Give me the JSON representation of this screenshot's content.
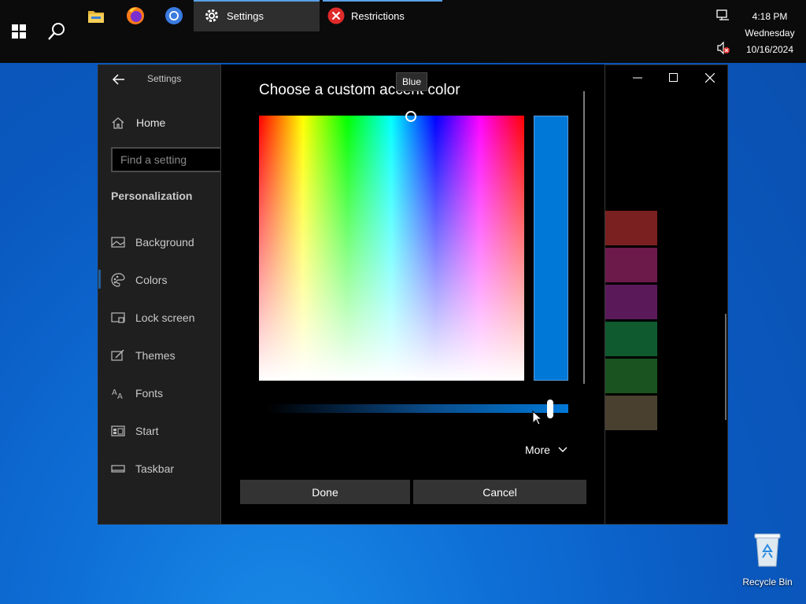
{
  "taskbar": {
    "settings_label": "Settings",
    "restrictions_label": "Restrictions",
    "time": "4:18 PM",
    "day": "Wednesday",
    "date": "10/16/2024"
  },
  "settings_window": {
    "title": "Settings",
    "home_label": "Home",
    "search_placeholder": "Find a setting",
    "section_title": "Personalization",
    "nav_items": [
      {
        "label": "Background",
        "icon": "image-icon"
      },
      {
        "label": "Colors",
        "icon": "palette-icon"
      },
      {
        "label": "Lock screen",
        "icon": "lock-screen-icon"
      },
      {
        "label": "Themes",
        "icon": "themes-icon"
      },
      {
        "label": "Fonts",
        "icon": "fonts-icon"
      },
      {
        "label": "Start",
        "icon": "start-icon"
      },
      {
        "label": "Taskbar",
        "icon": "taskbar-icon"
      }
    ],
    "selected_item": "Colors",
    "swatch_colors": [
      "#7b2020",
      "#6b1a4a",
      "#5a1a5a",
      "#0f5a2f",
      "#1a5220",
      "#4a4030"
    ]
  },
  "dialog": {
    "title": "Choose a custom accent color",
    "tooltip": "Blue",
    "preview_color": "#0078d7",
    "brightness_value": 0.95,
    "more_label": "More",
    "done_label": "Done",
    "cancel_label": "Cancel"
  },
  "desktop": {
    "recycle_bin_label": "Recycle Bin"
  }
}
